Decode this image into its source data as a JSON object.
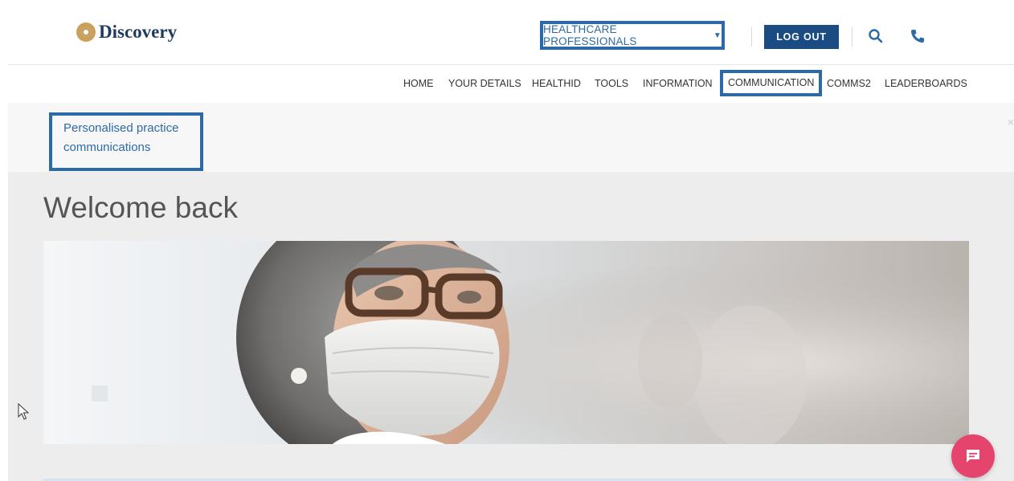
{
  "header": {
    "logo_text": "Discovery",
    "audience_dropdown": "HEALTHCARE PROFESSIONALS",
    "logout_label": "LOG OUT",
    "search_icon": "search-icon",
    "phone_icon": "phone-icon"
  },
  "nav": {
    "items": [
      {
        "label": "HOME"
      },
      {
        "label": "YOUR DETAILS"
      },
      {
        "label": "HEALTHID"
      },
      {
        "label": "TOOLS"
      },
      {
        "label": "INFORMATION"
      },
      {
        "label": "COMMUNICATION",
        "active": true
      },
      {
        "label": "COMMS2"
      },
      {
        "label": "LEADERBOARDS"
      }
    ]
  },
  "notice": {
    "line1": "Personalised practice",
    "line2": "communications",
    "close_glyph": "×"
  },
  "main": {
    "welcome_title": "Welcome back"
  },
  "colors": {
    "brand_blue": "#1a4b82",
    "highlight_blue": "#2b6aa6",
    "chat_pink": "#e5446d",
    "logo_gold": "#c9a15c"
  }
}
